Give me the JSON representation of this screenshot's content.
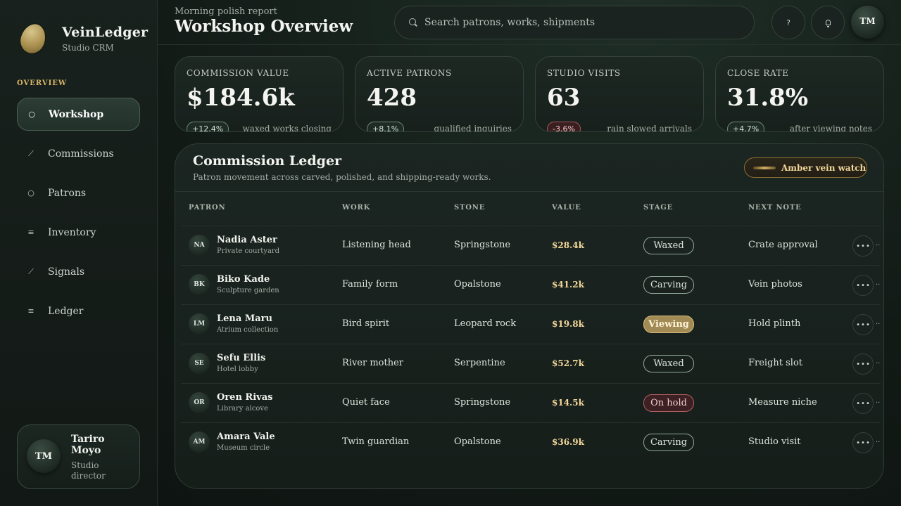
{
  "brand": {
    "name": "VeinLedger",
    "subtitle": "Studio CRM"
  },
  "nav": {
    "section": "OVERVIEW",
    "items": [
      {
        "label": "Workshop",
        "icon": "circle-icon",
        "glyph": "○"
      },
      {
        "label": "Commissions",
        "icon": "chisel-icon",
        "glyph": "⟋"
      },
      {
        "label": "Patrons",
        "icon": "circle-icon",
        "glyph": "○"
      },
      {
        "label": "Inventory",
        "icon": "stack-icon",
        "glyph": "≡"
      },
      {
        "label": "Signals",
        "icon": "trend-icon",
        "glyph": "⟋"
      },
      {
        "label": "Ledger",
        "icon": "list-icon",
        "glyph": "≡"
      }
    ]
  },
  "profile": {
    "initials": "TM",
    "name": "Tariro Moyo",
    "role": "Studio director"
  },
  "header": {
    "kicker": "Morning polish report",
    "title": "Workshop Overview",
    "search_placeholder": "Search patrons, works, shipments",
    "help_glyph": "?",
    "avatar_initials": "TM"
  },
  "stats": [
    {
      "label": "COMMISSION VALUE",
      "value": "$184.6k",
      "delta": "+12.4%",
      "note": "waxed works closing",
      "trend": "up"
    },
    {
      "label": "ACTIVE PATRONS",
      "value": "428",
      "delta": "+8.1%",
      "note": "qualified inquiries",
      "trend": "up"
    },
    {
      "label": "STUDIO VISITS",
      "value": "63",
      "delta": "-3.6%",
      "note": "rain slowed arrivals",
      "trend": "down"
    },
    {
      "label": "CLOSE RATE",
      "value": "31.8%",
      "delta": "+4.7%",
      "note": "after viewing notes",
      "trend": "up"
    }
  ],
  "ledger": {
    "title": "Commission Ledger",
    "subtitle": "Patron movement across carved, polished, and shipping-ready works.",
    "chip": "Amber vein watch",
    "columns": [
      "PATRON",
      "WORK",
      "STONE",
      "VALUE",
      "STAGE",
      "NEXT NOTE"
    ],
    "menu_glyph": "•••",
    "overflow_glyph": "..",
    "rows": [
      {
        "initials": "NA",
        "name": "Nadia Aster",
        "place": "Private courtyard",
        "work": "Listening head",
        "stone": "Springstone",
        "value": "$28.4k",
        "stage": "Waxed",
        "note": "Crate approval"
      },
      {
        "initials": "BK",
        "name": "Biko Kade",
        "place": "Sculpture garden",
        "work": "Family form",
        "stone": "Opalstone",
        "value": "$41.2k",
        "stage": "Carving",
        "note": "Vein photos"
      },
      {
        "initials": "LM",
        "name": "Lena Maru",
        "place": "Atrium collection",
        "work": "Bird spirit",
        "stone": "Leopard rock",
        "value": "$19.8k",
        "stage": "Viewing",
        "note": "Hold plinth"
      },
      {
        "initials": "SE",
        "name": "Sefu Ellis",
        "place": "Hotel lobby",
        "work": "River mother",
        "stone": "Serpentine",
        "value": "$52.7k",
        "stage": "Waxed",
        "note": "Freight slot"
      },
      {
        "initials": "OR",
        "name": "Oren Rivas",
        "place": "Library alcove",
        "work": "Quiet face",
        "stone": "Springstone",
        "value": "$14.5k",
        "stage": "On hold",
        "note": "Measure niche"
      },
      {
        "initials": "AM",
        "name": "Amara Vale",
        "place": "Museum circle",
        "work": "Twin guardian",
        "stone": "Opalstone",
        "value": "$36.9k",
        "stage": "Carving",
        "note": "Studio visit"
      }
    ]
  },
  "colors": {
    "accent_gold": "#d8b76a",
    "value_gold": "#f2d79a",
    "negative": "#a5575a",
    "positive": "#6c8a78"
  }
}
